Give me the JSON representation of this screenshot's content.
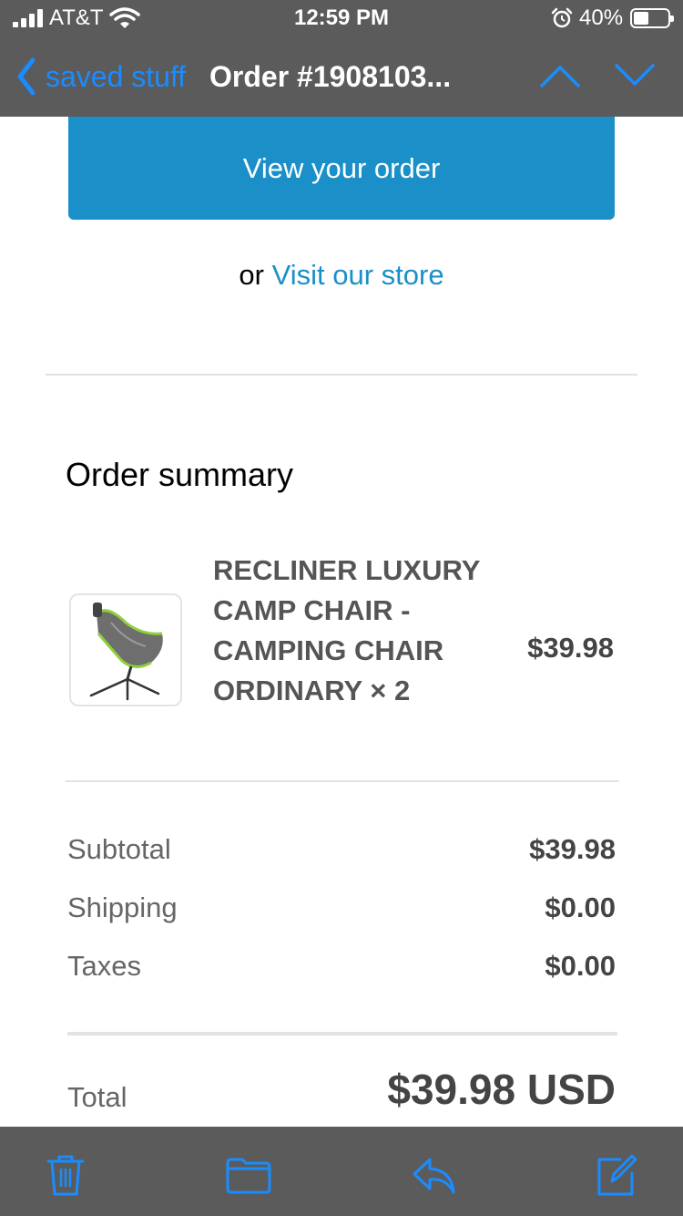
{
  "status_bar": {
    "carrier": "AT&T",
    "time": "12:59 PM",
    "battery": "40%",
    "battery_level": 0.4,
    "icons": [
      "signal-icon",
      "wifi-icon",
      "alarm-icon",
      "battery-icon"
    ]
  },
  "nav": {
    "back_label": "saved stuff",
    "title": "Order #1908103...",
    "icons": [
      "chevron-left-icon",
      "chevron-up-icon",
      "chevron-down-icon"
    ]
  },
  "content": {
    "view_order_label": "View your order",
    "or_text": "or",
    "visit_store_label": "Visit our store",
    "summary_title": "Order summary",
    "item": {
      "name": "RECLINER LUXURY CAMP CHAIR - CAMPING CHAIR ORDINARY × 2",
      "price": "$39.98"
    },
    "subtotal": {
      "label": "Subtotal",
      "value": "$39.98"
    },
    "shipping": {
      "label": "Shipping",
      "value": "$0.00"
    },
    "taxes": {
      "label": "Taxes",
      "value": "$0.00"
    },
    "total": {
      "label": "Total",
      "value": "$39.98 USD"
    }
  },
  "toolbar": {
    "icons": [
      "trash-icon",
      "folder-icon",
      "reply-icon",
      "compose-icon"
    ]
  },
  "colors": {
    "bar_bg": "#5b5b5b",
    "ios_blue": "#1a8cff",
    "button_blue": "#1b8fc8",
    "link_blue": "#1b8fc8"
  }
}
